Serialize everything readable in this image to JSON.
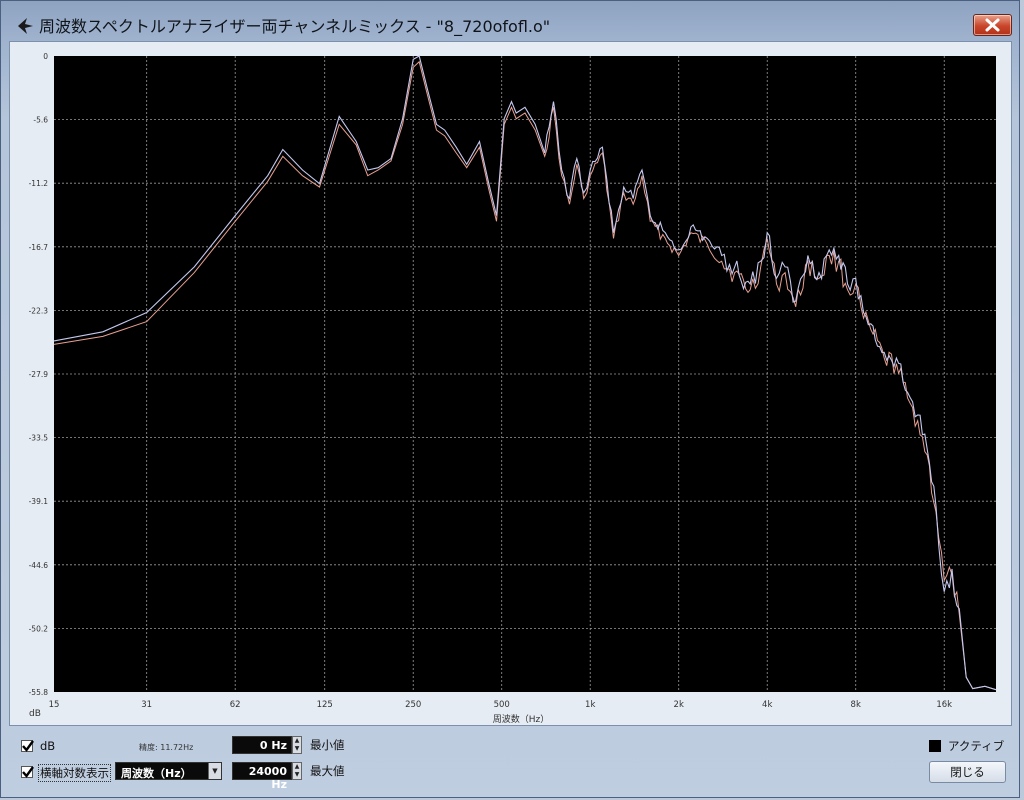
{
  "window": {
    "title": "周波数スペクトルアナライザー両チャンネルミックス - \"8_720ofofl.o\""
  },
  "chart_data": {
    "type": "line",
    "title": "",
    "xlabel": "周波数（Hz）",
    "ylabel": "dB",
    "x_scale": "log",
    "xlim": [
      15,
      24000
    ],
    "ylim": [
      -55.8,
      0
    ],
    "grid": true,
    "y_tick_labels": [
      "0",
      "-5.6",
      "-11.2",
      "-16.7",
      "-22.3",
      "-27.9",
      "-33.5",
      "-39.1",
      "-44.6",
      "-50.2",
      "-55.8"
    ],
    "x_tick_labels": [
      "15",
      "31",
      "62",
      "125",
      "250",
      "500",
      "1k",
      "2k",
      "4k",
      "8k",
      "16k"
    ],
    "x_tick_values": [
      15,
      31,
      62,
      125,
      250,
      500,
      1000,
      2000,
      4000,
      8000,
      16000
    ],
    "series": [
      {
        "color": "#e8a090",
        "x": [
          15,
          22,
          31,
          45,
          62,
          80,
          90,
          105,
          120,
          140,
          160,
          175,
          190,
          210,
          230,
          250,
          262,
          280,
          300,
          320,
          350,
          380,
          420,
          450,
          480,
          510,
          540,
          560,
          600,
          650,
          700,
          750,
          800,
          850,
          900,
          950,
          1000,
          1100,
          1200,
          1300,
          1400,
          1500,
          1600,
          1800,
          2000,
          2200,
          2500,
          2800,
          3100,
          3500,
          3800,
          4000,
          4300,
          4600,
          5000,
          5500,
          6000,
          6500,
          7000,
          7500,
          8000,
          8500,
          9000,
          10000,
          11000,
          12000,
          13000,
          14000,
          15000,
          16000,
          17000,
          18000,
          19000,
          20000,
          22000,
          24000
        ],
        "y": [
          -25.3,
          -24.6,
          -23.3,
          -19.0,
          -14.5,
          -11.0,
          -8.8,
          -10.5,
          -11.5,
          -6.0,
          -7.8,
          -10.5,
          -10.0,
          -9.2,
          -6.0,
          -1.0,
          -0.5,
          -3.5,
          -6.5,
          -7.0,
          -8.5,
          -9.8,
          -8.0,
          -11.5,
          -14.5,
          -6.0,
          -4.5,
          -5.5,
          -5.0,
          -6.5,
          -8.8,
          -4.5,
          -10.5,
          -13.0,
          -9.5,
          -12.5,
          -10.5,
          -8.5,
          -16.0,
          -12.0,
          -13.0,
          -10.5,
          -14.5,
          -16.0,
          -17.5,
          -15.5,
          -16.5,
          -18.0,
          -19.0,
          -20.5,
          -18.5,
          -16.0,
          -20.0,
          -19.0,
          -22.0,
          -18.0,
          -19.5,
          -17.5,
          -18.0,
          -20.5,
          -20.0,
          -23.0,
          -24.0,
          -26.5,
          -27.0,
          -30.0,
          -32.0,
          -35.0,
          -40.0,
          -46.0,
          -45.5,
          -49.0,
          -54.5,
          -55.5,
          -55.3,
          -55.6
        ]
      },
      {
        "color": "#c4c8ee",
        "x": [
          15,
          22,
          31,
          45,
          62,
          80,
          90,
          105,
          120,
          140,
          160,
          175,
          190,
          210,
          230,
          250,
          262,
          280,
          300,
          320,
          350,
          380,
          420,
          450,
          480,
          510,
          540,
          560,
          600,
          650,
          700,
          750,
          800,
          850,
          900,
          950,
          1000,
          1100,
          1200,
          1300,
          1400,
          1500,
          1600,
          1800,
          2000,
          2200,
          2500,
          2800,
          3100,
          3500,
          3800,
          4000,
          4300,
          4600,
          5000,
          5500,
          6000,
          6500,
          7000,
          7500,
          8000,
          8500,
          9000,
          10000,
          11000,
          12000,
          13000,
          14000,
          15000,
          16000,
          17000,
          18000,
          19000,
          20000,
          22000,
          24000
        ],
        "y": [
          -25.0,
          -24.2,
          -22.5,
          -18.5,
          -14.0,
          -10.5,
          -8.2,
          -10.0,
          -11.2,
          -5.3,
          -7.5,
          -10.0,
          -9.8,
          -9.0,
          -5.5,
          -0.3,
          0.0,
          -3.0,
          -6.0,
          -6.5,
          -8.0,
          -9.5,
          -7.5,
          -11.0,
          -14.0,
          -5.5,
          -4.0,
          -5.0,
          -4.5,
          -6.0,
          -8.5,
          -4.0,
          -10.0,
          -12.5,
          -9.0,
          -12.0,
          -10.0,
          -8.0,
          -15.5,
          -11.5,
          -12.5,
          -10.0,
          -14.0,
          -15.5,
          -17.0,
          -15.0,
          -16.0,
          -17.5,
          -18.5,
          -20.0,
          -18.0,
          -15.5,
          -19.5,
          -18.5,
          -21.5,
          -17.5,
          -19.0,
          -17.0,
          -17.5,
          -20.0,
          -19.5,
          -22.5,
          -23.5,
          -26.0,
          -26.5,
          -29.5,
          -31.5,
          -34.5,
          -39.5,
          -47.0,
          -45.0,
          -48.5,
          -54.5,
          -55.5,
          -55.3,
          -55.6
        ]
      }
    ]
  },
  "controls": {
    "db_label": "dB",
    "resolution_text": "精度: 11.72Hz",
    "min_value": "0 Hz",
    "min_label": "最小値",
    "max_value": "24000 Hz",
    "max_label": "最大値",
    "log_axis_label": "横軸対数表示",
    "axis_mode_value": "周波数（Hz）",
    "active_label": "アクティブ",
    "close_label": "閉じる"
  },
  "colors": {
    "plot_background": "#000000",
    "grid": "#9a9a9a"
  }
}
